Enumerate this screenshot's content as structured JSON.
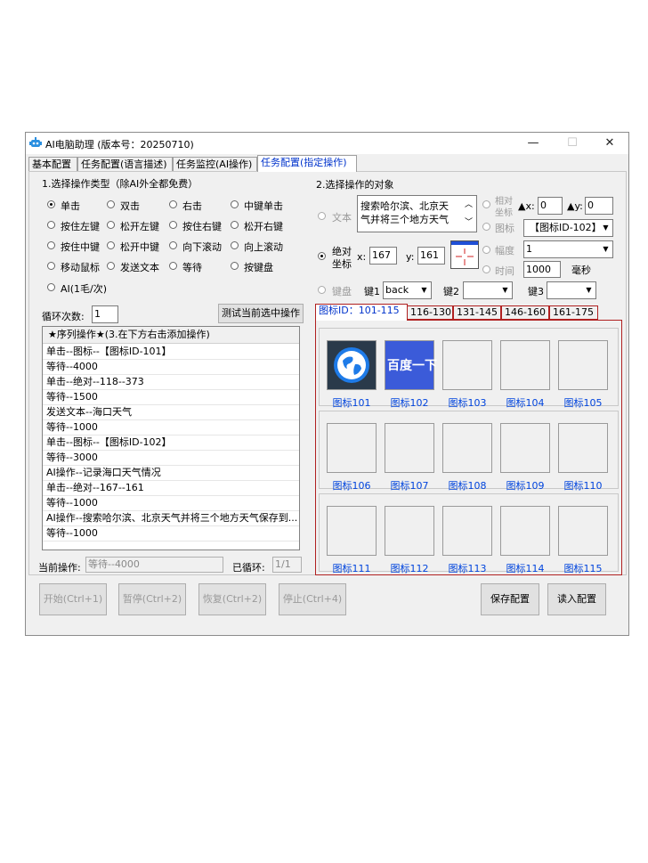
{
  "window": {
    "title": "AI电脑助理 (版本号：20250710)",
    "min_glyph": "—",
    "max_glyph": "☐",
    "close_glyph": "✕"
  },
  "tabs": [
    {
      "label": "基本配置"
    },
    {
      "label": "任务配置(语言描述)"
    },
    {
      "label": "任务监控(AI操作)"
    },
    {
      "label": "任务配置(指定操作)"
    }
  ],
  "section1": {
    "title": "1.选择操作类型（除AI外全都免费）",
    "options": [
      "单击",
      "双击",
      "右击",
      "中键单击",
      "按住左键",
      "松开左键",
      "按住右键",
      "松开右键",
      "按住中键",
      "松开中键",
      "向下滚动",
      "向上滚动",
      "移动鼠标",
      "发送文本",
      "等待",
      "按键盘",
      "AI(1毛/次)"
    ],
    "selected_index": 0
  },
  "loop": {
    "label": "循环次数:",
    "value": "1",
    "test_button": "测试当前选中操作"
  },
  "sequence": {
    "header": "★序列操作★(3.在下方右击添加操作)",
    "rows": [
      "单击--图标--【图标ID-101】",
      "等待--4000",
      "单击--绝对--118--373",
      "等待--1500",
      "发送文本--海口天气",
      "等待--1000",
      "单击--图标--【图标ID-102】",
      "等待--3000",
      "AI操作--记录海口天气情况",
      "单击--绝对--167--161",
      "等待--1000",
      "AI操作--搜索哈尔滨、北京天气并将三个地方天气保存到...",
      "等待--1000"
    ]
  },
  "status": {
    "current_label": "当前操作:",
    "current_value": "等待--4000",
    "loop_label": "已循环:",
    "loop_value": "1/1"
  },
  "section2": {
    "title": "2.选择操作的对象",
    "text_label": "文本",
    "text_value_line1": "搜索哈尔滨、北京天",
    "text_value_line2": "气并将三个地方天气",
    "relative_label_1": "相对",
    "relative_label_2": "坐标",
    "dx_label": "▲x:",
    "dx_value": "0",
    "dy_label": "▲y:",
    "dy_value": "0",
    "icon_label": "图标",
    "icon_value": "【图标ID-102】",
    "absolute_label_1": "绝对",
    "absolute_label_2": "坐标",
    "x_label": "x:",
    "x_value": "167",
    "y_label": "y:",
    "y_value": "161",
    "amplitude_label": "幅度",
    "amplitude_value": "1",
    "time_label": "时间",
    "time_value": "1000",
    "time_unit": "毫秒",
    "keyboard_label": "键盘",
    "key1_label": "键1",
    "key1_value": "back",
    "key2_label": "键2",
    "key2_value": "",
    "key3_label": "键3",
    "key3_value": ""
  },
  "icon_tabs": [
    "图标ID：101-115",
    "116-130",
    "131-145",
    "146-160",
    "161-175"
  ],
  "icons": [
    "图标101",
    "图标102",
    "图标103",
    "图标104",
    "图标105",
    "图标106",
    "图标107",
    "图标108",
    "图标109",
    "图标110",
    "图标111",
    "图标112",
    "图标113",
    "图标114",
    "图标115"
  ],
  "icon102_text": "百度一下",
  "buttons": {
    "start": "开始(Ctrl+1)",
    "pause": "暂停(Ctrl+2)",
    "resume": "恢复(Ctrl+2)",
    "stop": "停止(Ctrl+4)",
    "save": "保存配置",
    "load": "读入配置"
  },
  "colors": {
    "accent_blue": "#0033cc",
    "tab_border_red": "#b02020",
    "icon101_bg": "#1e63c8",
    "icon102_bg": "#3b5bd9"
  }
}
